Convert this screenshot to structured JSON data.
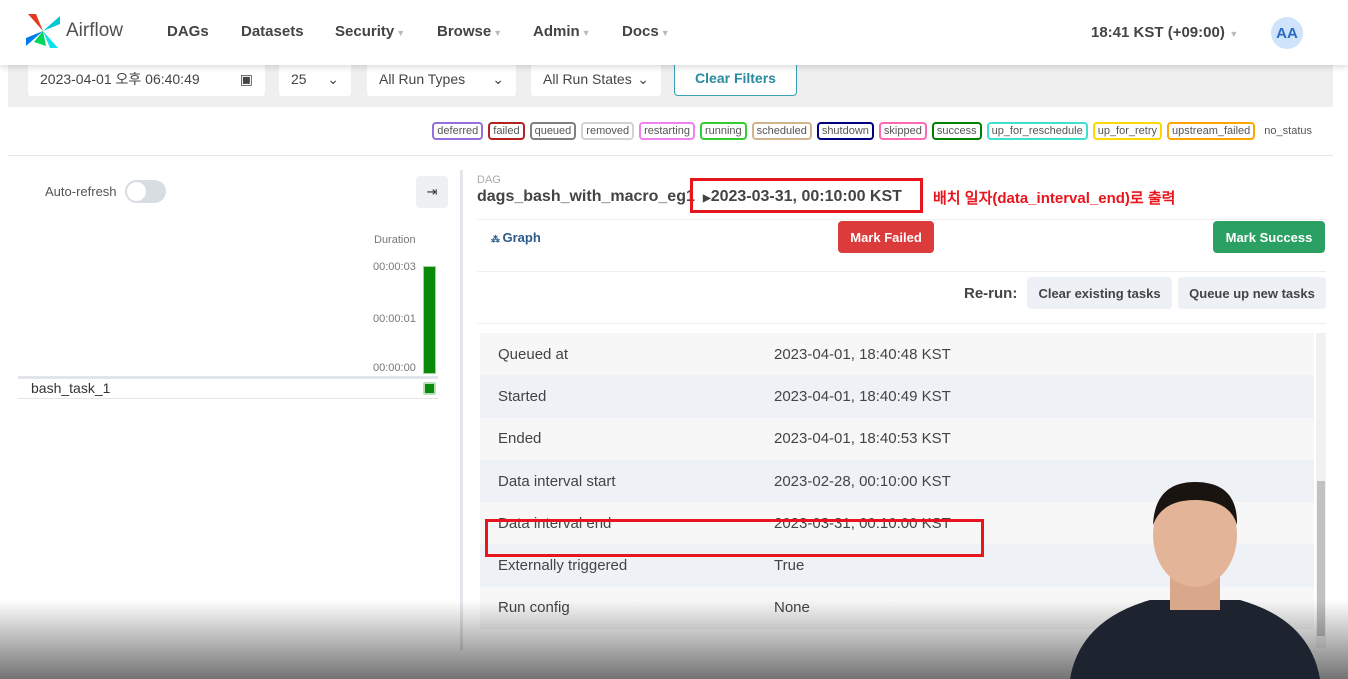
{
  "nav": {
    "brand": "Airflow",
    "items": [
      "DAGs",
      "Datasets",
      "Security",
      "Browse",
      "Admin",
      "Docs"
    ],
    "time": "18:41 KST (+09:00)",
    "avatar": "AA"
  },
  "filters": {
    "date": "2023-04-01 오후 06:40:49",
    "page_size": "25",
    "run_type": "All Run Types",
    "run_state": "All Run States",
    "clear": "Clear Filters"
  },
  "legend": [
    {
      "label": "deferred",
      "color": "#9370db"
    },
    {
      "label": "failed",
      "color": "#b22222"
    },
    {
      "label": "queued",
      "color": "#808080"
    },
    {
      "label": "removed",
      "color": "#d3d3d3"
    },
    {
      "label": "restarting",
      "color": "#ee82ee"
    },
    {
      "label": "running",
      "color": "#32cd32"
    },
    {
      "label": "scheduled",
      "color": "#d2b48c"
    },
    {
      "label": "shutdown",
      "color": "#000080"
    },
    {
      "label": "skipped",
      "color": "#ff69b4"
    },
    {
      "label": "success",
      "color": "#008000"
    },
    {
      "label": "up_for_reschedule",
      "color": "#40e0d0"
    },
    {
      "label": "up_for_retry",
      "color": "#ffd700"
    },
    {
      "label": "upstream_failed",
      "color": "#ffa500"
    },
    {
      "label": "no_status",
      "color": ""
    }
  ],
  "grid": {
    "auto_refresh": "Auto-refresh",
    "duration": "Duration",
    "ticks": [
      "00:00:03",
      "00:00:01",
      "00:00:00"
    ],
    "task": "bash_task_1"
  },
  "details": {
    "dag_label": "DAG",
    "dag_id": "dags_bash_with_macro_eg1",
    "run": "2023-03-31, 00:10:00 KST",
    "annotation": "배치 일자(data_interval_end)로 출력",
    "graph": "Graph",
    "mark_failed": "Mark Failed",
    "mark_success": "Mark Success",
    "rerun": "Re-run:",
    "clear_tasks": "Clear existing tasks",
    "queue_tasks": "Queue up new tasks",
    "rows": [
      {
        "k": "Queued at",
        "v": "2023-04-01, 18:40:48 KST"
      },
      {
        "k": "Started",
        "v": "2023-04-01, 18:40:49 KST"
      },
      {
        "k": "Ended",
        "v": "2023-04-01, 18:40:53 KST"
      },
      {
        "k": "Data interval start",
        "v": "2023-02-28, 00:10:00 KST"
      },
      {
        "k": "Data interval end",
        "v": "2023-03-31, 00:10:00 KST"
      },
      {
        "k": "Externally triggered",
        "v": "True"
      },
      {
        "k": "Run config",
        "v": "None"
      }
    ]
  }
}
